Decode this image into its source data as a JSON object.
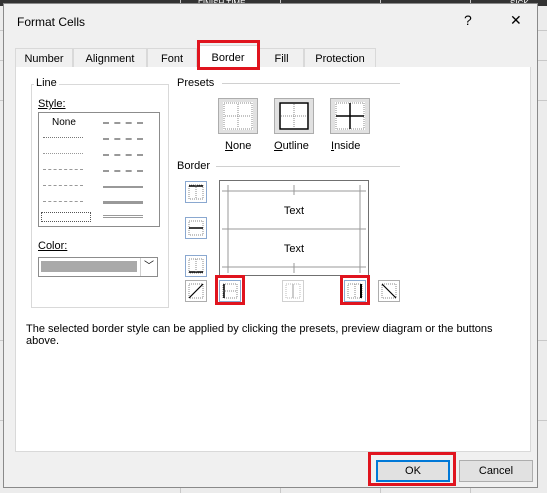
{
  "background_sheet": {
    "col_headers": [
      "FINISH TIME",
      "SICK"
    ]
  },
  "dialog": {
    "title": "Format Cells",
    "help_label": "?",
    "close_label": "✕"
  },
  "tabs": [
    {
      "label": "Number",
      "active": false
    },
    {
      "label": "Alignment",
      "active": false
    },
    {
      "label": "Font",
      "active": false
    },
    {
      "label": "Border",
      "active": true
    },
    {
      "label": "Fill",
      "active": false
    },
    {
      "label": "Protection",
      "active": false
    }
  ],
  "line": {
    "group_label": "Line",
    "style_label": "Style:",
    "none_label": "None",
    "color_label": "Color:",
    "color_value": "#a9a9a9"
  },
  "presets": {
    "group_label": "Presets",
    "items": [
      {
        "label": "None",
        "mnemonic": "N",
        "rest": "one"
      },
      {
        "label": "Outline",
        "mnemonic": "O",
        "rest": "utline"
      },
      {
        "label": "Inside",
        "mnemonic": "I",
        "rest": "nside"
      }
    ]
  },
  "border": {
    "group_label": "Border",
    "preview_text": [
      "Text",
      "Text"
    ]
  },
  "description": "The selected border style can be applied by clicking the presets, preview diagram or the buttons above.",
  "buttons": {
    "ok": "OK",
    "cancel": "Cancel"
  },
  "colors": {
    "highlight": "#e0141e",
    "focus": "#0078d7"
  }
}
